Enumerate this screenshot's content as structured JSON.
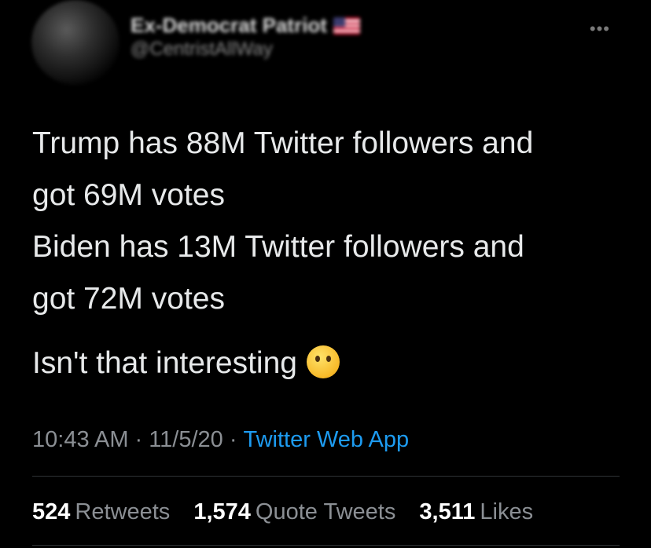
{
  "author": {
    "display_name": "Ex-Democrat Patriot",
    "handle": "@CentristAllWay",
    "flag_icon": "us-flag-icon"
  },
  "more_icon": "•••",
  "tweet": {
    "lines": [
      "Trump has 88M Twitter followers and",
      "got 69M votes",
      "Biden has 13M Twitter followers and",
      "got 72M votes"
    ],
    "closing": "Isn't that interesting",
    "emoji_icon": "thinking-face-icon"
  },
  "meta": {
    "time": "10:43 AM",
    "date": "11/5/20",
    "separator": "·",
    "source": "Twitter Web App",
    "source_color": "#1d9bf0"
  },
  "stats": [
    {
      "count": "524",
      "label": "Retweets"
    },
    {
      "count": "1,574",
      "label": "Quote Tweets"
    },
    {
      "count": "3,511",
      "label": "Likes"
    }
  ]
}
